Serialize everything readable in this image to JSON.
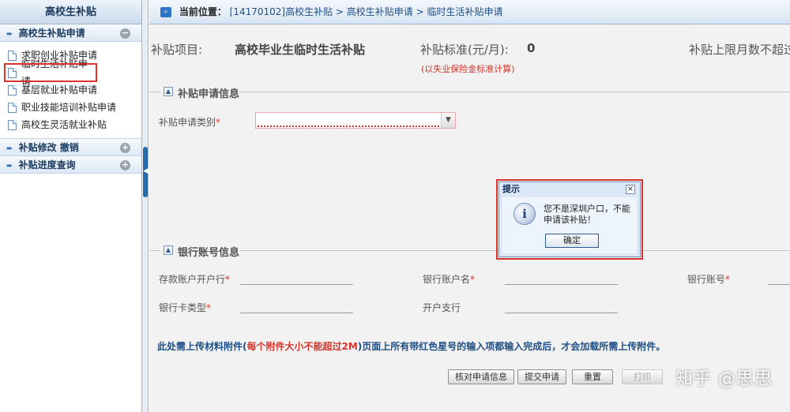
{
  "sidebar": {
    "title": "高校生补贴",
    "groups": [
      {
        "label": "高校生补贴申请",
        "toggle": "−",
        "items": [
          {
            "label": "求职创业补贴申请"
          },
          {
            "label": "临时生活补贴申请"
          },
          {
            "label": "基层就业补贴申请"
          },
          {
            "label": "职业技能培训补贴申请"
          },
          {
            "label": "高校生灵活就业补贴"
          }
        ]
      },
      {
        "label": "补贴修改 撤销",
        "toggle": "+"
      },
      {
        "label": "补贴进度查询",
        "toggle": "+"
      }
    ]
  },
  "breadcrumb": {
    "label": "当前位置：",
    "path": "[14170102]高校生补贴 > 高校生补贴申请 > 临时生活补贴申请"
  },
  "subsidy": {
    "item_label": "补贴项目:",
    "item_value": "高校毕业生临时生活补贴",
    "standard_label": "补贴标准(元/月):",
    "standard_value": "0",
    "standard_note": "(以失业保险金标准计算)",
    "max_months_label": "补贴上限月数不超过"
  },
  "sections": {
    "apply_info": "补贴申请信息",
    "bank_info": "银行账号信息"
  },
  "form": {
    "apply_type_label": "补贴申请类别",
    "bank_open_label": "存款账户开户行",
    "account_name_label": "银行账户名",
    "account_no_label": "银行账号",
    "card_type_label": "银行卡类型",
    "branch_label": "开户支行",
    "required_mark": "*"
  },
  "upload_note": {
    "prefix": "此处需上传材料附件(",
    "highlight": "每个附件大小不能超过2M",
    "suffix": ")页面上所有带红色星号的输入项都输入完成后，才会加载所需上传附件。"
  },
  "actions": {
    "check": "核对申请信息",
    "submit": "提交申请",
    "reset": "重置",
    "print": "打印"
  },
  "dialog": {
    "title": "提示",
    "close": "×",
    "icon": "i",
    "message": "您不是深圳户口，不能申请该补贴！",
    "ok": "确定"
  },
  "watermark": "知乎 @思思",
  "colors": {
    "accent": "#2a6aa8",
    "alert": "#d9342b"
  }
}
